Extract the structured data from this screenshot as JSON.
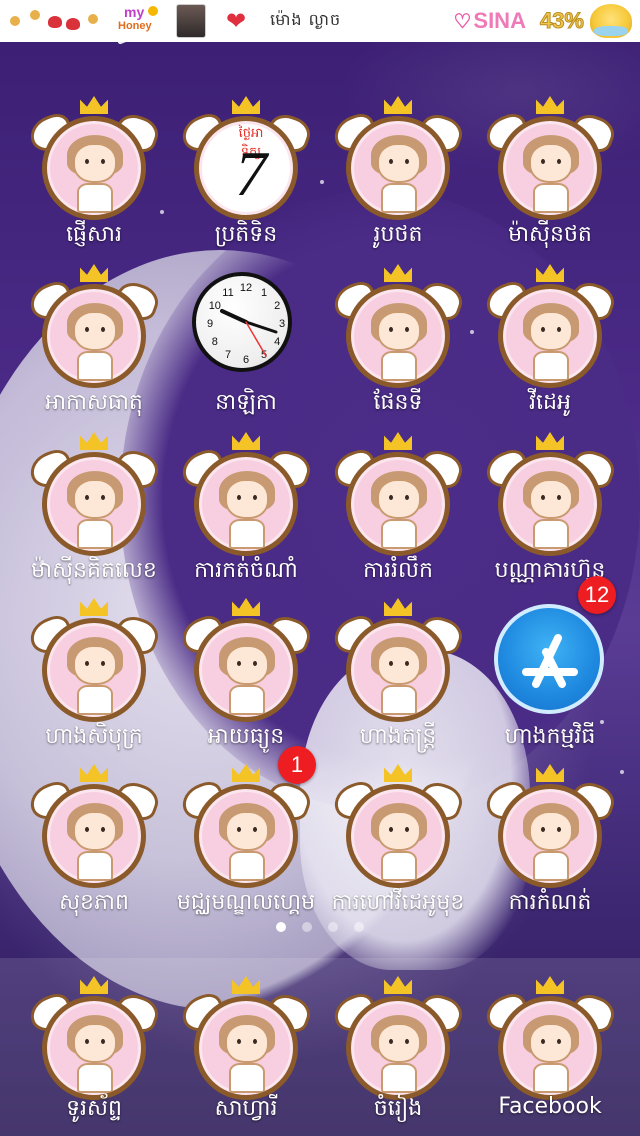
{
  "status_bar": {
    "time": "ម៉ោង ល្ងាច",
    "my": "my",
    "honey": "Honey",
    "sina": "SINA",
    "battery": "43%"
  },
  "apps": [
    {
      "label": "ផ្ញើសារ",
      "icon": "messages-icon"
    },
    {
      "label": "ប្រតិទិន",
      "icon": "calendar-icon",
      "day": "ថ្ងៃអាទិត្យ",
      "date": "7"
    },
    {
      "label": "រូបថត",
      "icon": "photos-icon"
    },
    {
      "label": "ម៉ាស៊ីនថត",
      "icon": "camera-icon"
    },
    {
      "label": "អាកាសធាតុ",
      "icon": "weather-icon"
    },
    {
      "label": "នាឡិកា",
      "icon": "clock-icon"
    },
    {
      "label": "ផែនទី",
      "icon": "maps-icon"
    },
    {
      "label": "វីដេអូ",
      "icon": "videos-icon"
    },
    {
      "label": "ម៉ាស៊ីនគិតលេខ",
      "icon": "calculator-icon"
    },
    {
      "label": "ការកត់ចំណាំ",
      "icon": "notes-icon"
    },
    {
      "label": "ការរំលឹក",
      "icon": "reminders-icon"
    },
    {
      "label": "បណ្ណាគារហ៊ុន",
      "icon": "stocks-icon"
    },
    {
      "label": "ហាងសិបុក្រ",
      "icon": "ibooks-icon"
    },
    {
      "label": "អាយធ្យូន",
      "icon": "itunes-icon"
    },
    {
      "label": "ហាងតន្ត្រី",
      "icon": "itunes-store-icon"
    },
    {
      "label": "ហាងកម្មវិធី",
      "icon": "app-store-icon",
      "badge": "12"
    },
    {
      "label": "សុខភាព",
      "icon": "health-icon"
    },
    {
      "label": "មជ្ឈមណ្ឌលហ្គេម",
      "icon": "game-center-icon",
      "badge": "1"
    },
    {
      "label": "ការហៅវីដេអូមុខ",
      "icon": "facetime-icon"
    },
    {
      "label": "ការកំណត់",
      "icon": "settings-icon"
    }
  ],
  "dock": [
    {
      "label": "ទូរស័ព្ទ",
      "icon": "phone-icon"
    },
    {
      "label": "សាហ្វារី",
      "icon": "safari-icon"
    },
    {
      "label": "ចំរៀង",
      "icon": "music-icon"
    },
    {
      "label": "Facebook",
      "icon": "facebook-icon"
    }
  ],
  "page_dots": {
    "count": 4,
    "active": 0
  },
  "colors": {
    "badge_red": "#ee1d22",
    "icon_circle_pink": "#f8cfe0",
    "icon_border_brown": "#8a5a2a",
    "label_white": "#ffffff",
    "app_store_blue": "#1e88df"
  }
}
